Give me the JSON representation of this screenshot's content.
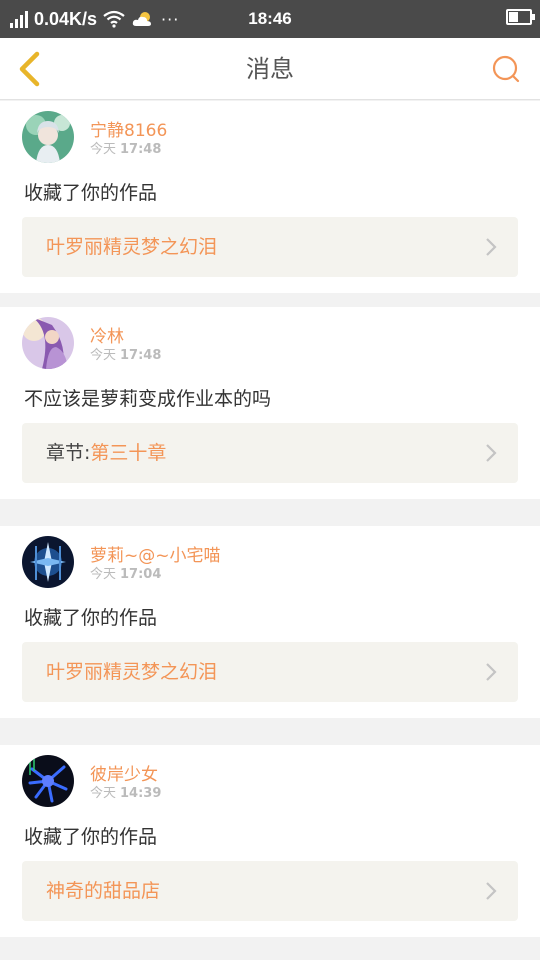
{
  "status_bar": {
    "net_speed": "0.04K/s",
    "time": "18:46",
    "more": "···"
  },
  "header": {
    "title": "消息",
    "accent_color": "#f39557",
    "back_icon": "chevron-left-icon",
    "search_icon": "search-icon"
  },
  "messages": [
    {
      "user": "宁静8166",
      "day": "今天",
      "time": "17:48",
      "text": "收藏了你的作品",
      "ref_prefix": "",
      "ref_title": "叶罗丽精灵梦之幻泪"
    },
    {
      "user": "冷林",
      "day": "今天",
      "time": "17:48",
      "text": "不应该是萝莉变成作业本的吗",
      "ref_prefix": "章节:",
      "ref_title": "第三十章"
    },
    {
      "user": "萝莉~@~小宅喵",
      "day": "今天",
      "time": "17:04",
      "text": "收藏了你的作品",
      "ref_prefix": "",
      "ref_title": "叶罗丽精灵梦之幻泪"
    },
    {
      "user": "彼岸少女",
      "day": "今天",
      "time": "14:39",
      "text": "收藏了你的作品",
      "ref_prefix": "",
      "ref_title": "神奇的甜品店"
    }
  ]
}
